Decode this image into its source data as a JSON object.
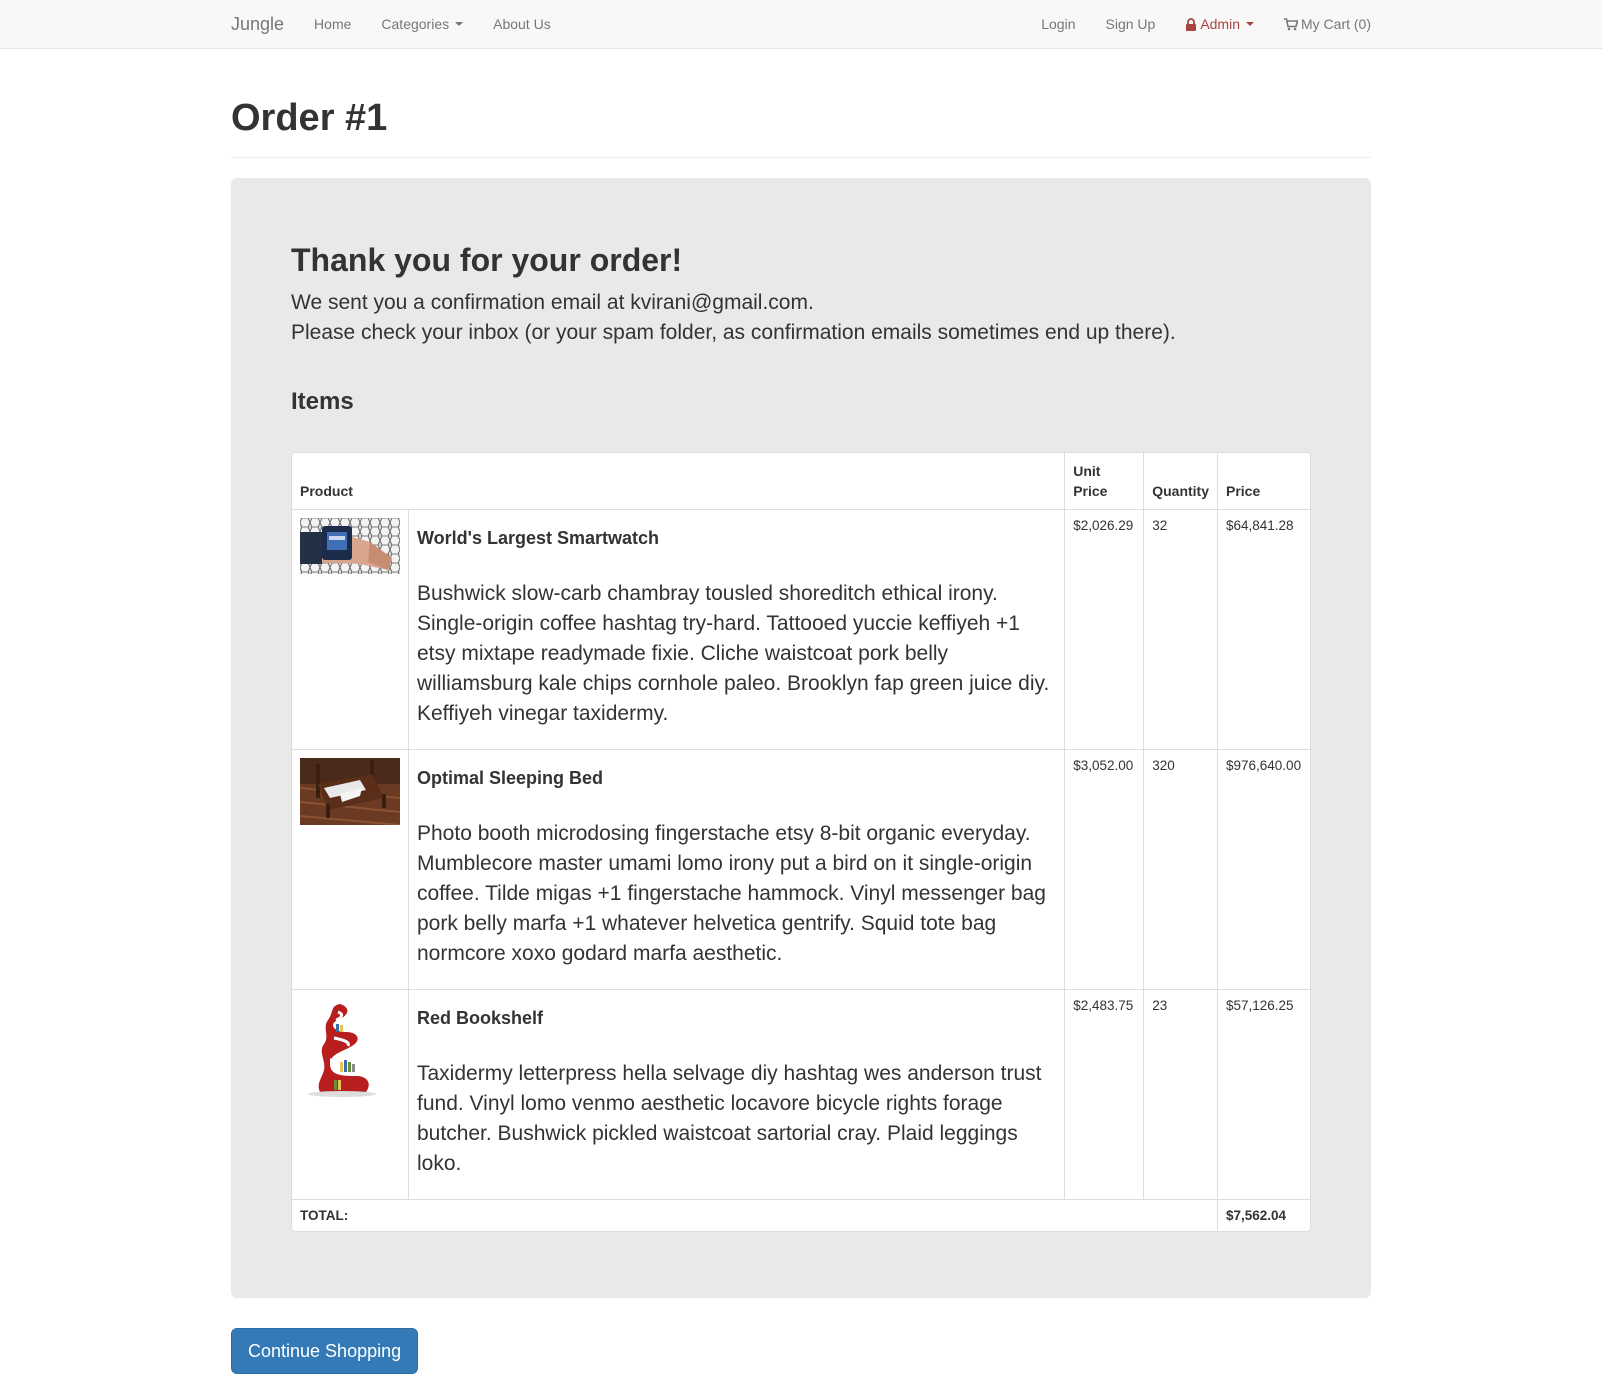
{
  "navbar": {
    "brand": "Jungle",
    "home": "Home",
    "categories": "Categories",
    "about": "About Us",
    "login": "Login",
    "signup": "Sign Up",
    "admin": "Admin",
    "cart": "My Cart (0)"
  },
  "page": {
    "title": "Order #1"
  },
  "confirmation": {
    "heading": "Thank you for your order!",
    "line1": "We sent you a confirmation email at kvirani@gmail.com.",
    "line2": "Please check your inbox (or your spam folder, as confirmation emails sometimes end up there).",
    "items_heading": "Items"
  },
  "table": {
    "headers": {
      "product": "Product",
      "unit_price": "Unit Price",
      "quantity": "Quantity",
      "price": "Price"
    },
    "rows": [
      {
        "name": "World's Largest Smartwatch",
        "description": "Bushwick slow-carb chambray tousled shoreditch ethical irony. Single-origin coffee hashtag try-hard. Tattooed yuccie keffiyeh +1 etsy mixtape readymade fixie. Cliche waistcoat pork belly williamsburg kale chips cornhole paleo. Brooklyn fap green juice diy. Keffiyeh vinegar taxidermy.",
        "unit_price": "$2,026.29",
        "quantity": "32",
        "price": "$64,841.28"
      },
      {
        "name": "Optimal Sleeping Bed",
        "description": "Photo booth microdosing fingerstache etsy 8-bit organic everyday. Mumblecore master umami lomo irony put a bird on it single-origin coffee. Tilde migas +1 fingerstache hammock. Vinyl messenger bag pork belly marfa +1 whatever helvetica gentrify. Squid tote bag normcore xoxo godard marfa aesthetic.",
        "unit_price": "$3,052.00",
        "quantity": "320",
        "price": "$976,640.00"
      },
      {
        "name": "Red Bookshelf",
        "description": "Taxidermy letterpress hella selvage diy hashtag wes anderson trust fund. Vinyl lomo venmo aesthetic locavore bicycle rights forage butcher. Bushwick pickled waistcoat sartorial cray. Plaid leggings loko.",
        "unit_price": "$2,483.75",
        "quantity": "23",
        "price": "$57,126.25"
      }
    ],
    "total_label": "TOTAL:",
    "total_value": "$7,562.04"
  },
  "actions": {
    "continue": "Continue Shopping"
  },
  "colors": {
    "navbar_bg": "#f8f8f8",
    "admin": "#a94442",
    "primary_button": "#337ab7",
    "panel_bg": "#e9e9e9"
  }
}
